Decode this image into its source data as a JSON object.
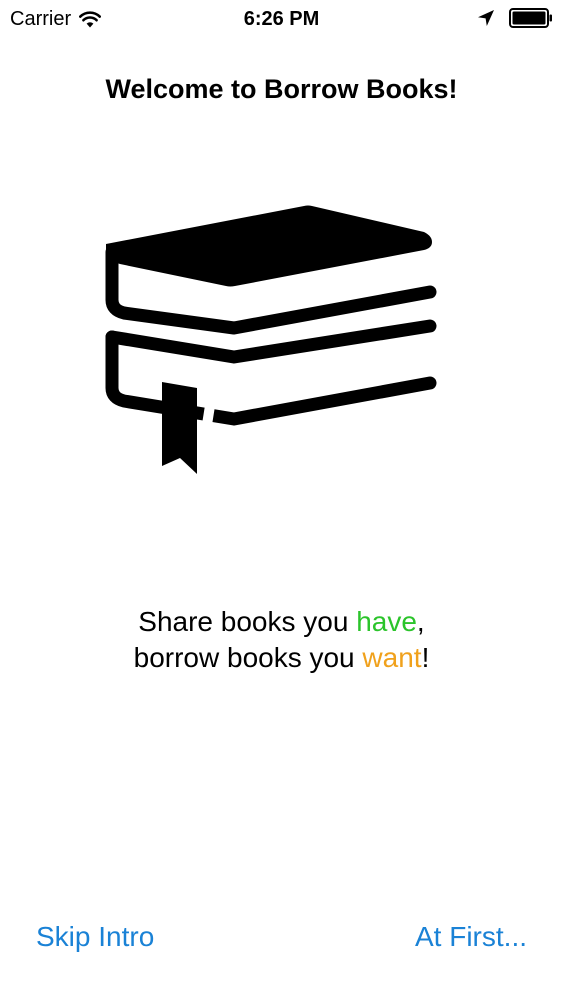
{
  "status_bar": {
    "carrier": "Carrier",
    "time": "6:26 PM",
    "icons": [
      "wifi-icon",
      "location-icon",
      "battery-icon"
    ]
  },
  "intro": {
    "title": "Welcome to Borrow Books!",
    "illustration_icon": "books-stack-icon",
    "tagline": {
      "line1_prefix": "Share books you ",
      "line1_highlight": "have",
      "line1_suffix": ",",
      "line2_prefix": "borrow books you ",
      "line2_highlight": "want",
      "line2_suffix": "!"
    }
  },
  "colors": {
    "have": "#2bc42b",
    "want": "#f0a11c",
    "link": "#1a82d6"
  },
  "buttons": {
    "skip_label": "Skip Intro",
    "next_label": "At First..."
  }
}
